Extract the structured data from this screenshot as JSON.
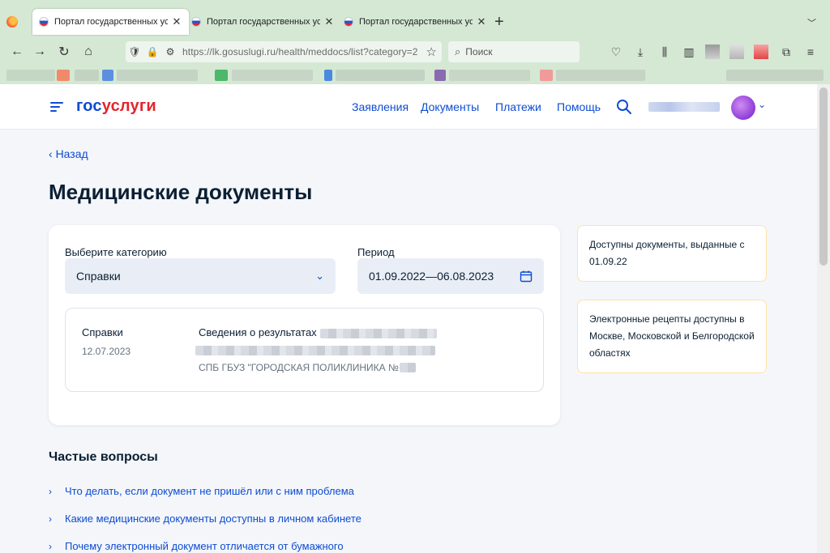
{
  "browser": {
    "tabs": [
      {
        "title": "Портал государственных услуг",
        "active": true
      },
      {
        "title": "Портал государственных услуг",
        "active": false
      },
      {
        "title": "Портал государственных услуг",
        "active": false
      }
    ],
    "new_tab_icon": "plus-icon",
    "tab_list_icon": "chevron-down-icon",
    "url": "https://lk.gosuslugi.ru/health/meddocs/list?category=2",
    "search_placeholder": "Поиск"
  },
  "site": {
    "logo_part1": "гос",
    "logo_part2": "услуги",
    "nav": [
      "Заявления",
      "Документы",
      "Платежи",
      "Помощь"
    ]
  },
  "page": {
    "back_label": "Назад",
    "title": "Медицинские документы",
    "category_label": "Выберите категорию",
    "category_value": "Справки",
    "period_label": "Период",
    "period_value": "01.09.2022—06.08.2023",
    "document": {
      "category": "Справки",
      "date": "12.07.2023",
      "title": "Сведения о результатах",
      "org": "СПБ ГБУЗ \"ГОРОДСКАЯ ПОЛИКЛИНИКА №"
    },
    "info_cards": [
      "Доступны документы, выданные с 01.09.22",
      "Электронные рецепты доступны в Москве, Московской и Белгородской областях"
    ],
    "faq_title": "Частые вопросы",
    "faq": [
      "Что делать, если документ не пришёл или с ним проблема",
      "Какие медицинские документы доступны в личном кабинете",
      "Почему электронный документ отличается от бумажного"
    ]
  },
  "colors": {
    "brand_blue": "#0d4cd3",
    "brand_red": "#e3242b",
    "browser_chrome": "#d4e8d4",
    "page_bg": "#f4f6fa",
    "info_border": "#ffe3a6"
  }
}
